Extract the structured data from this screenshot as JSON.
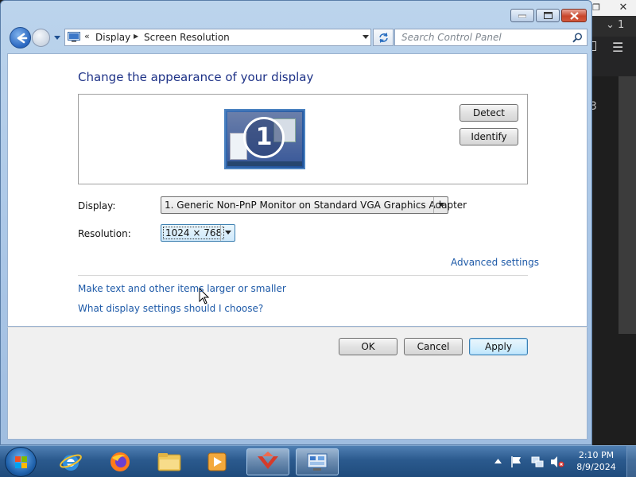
{
  "window": {
    "breadcrumb": {
      "overflow": "«",
      "items": [
        "Display",
        "Screen Resolution"
      ]
    },
    "search_placeholder": "Search Control Panel"
  },
  "main": {
    "title": "Change the appearance of your display",
    "monitor_number": "1",
    "detect_label": "Detect",
    "identify_label": "Identify",
    "display_label": "Display:",
    "display_value": "1. Generic Non-PnP Monitor on Standard VGA Graphics Adapter",
    "resolution_label": "Resolution:",
    "resolution_value": "1024 × 768",
    "advanced_link": "Advanced settings",
    "links": [
      "Make text and other items larger or smaller",
      "What display settings should I choose?"
    ]
  },
  "buttons": {
    "ok": "OK",
    "cancel": "Cancel",
    "apply": "Apply"
  },
  "background_app": {
    "tab_number": "1",
    "side_char": "3"
  },
  "taskbar": {
    "time": "2:10 PM",
    "date": "8/9/2024",
    "apps": [
      "internet-explorer",
      "firefox",
      "file-explorer",
      "media-player",
      "red-app",
      "control-panel"
    ]
  },
  "colors": {
    "title": "#1e3287",
    "link": "#1e5aa8",
    "taskbar": "#2b5a8e"
  }
}
